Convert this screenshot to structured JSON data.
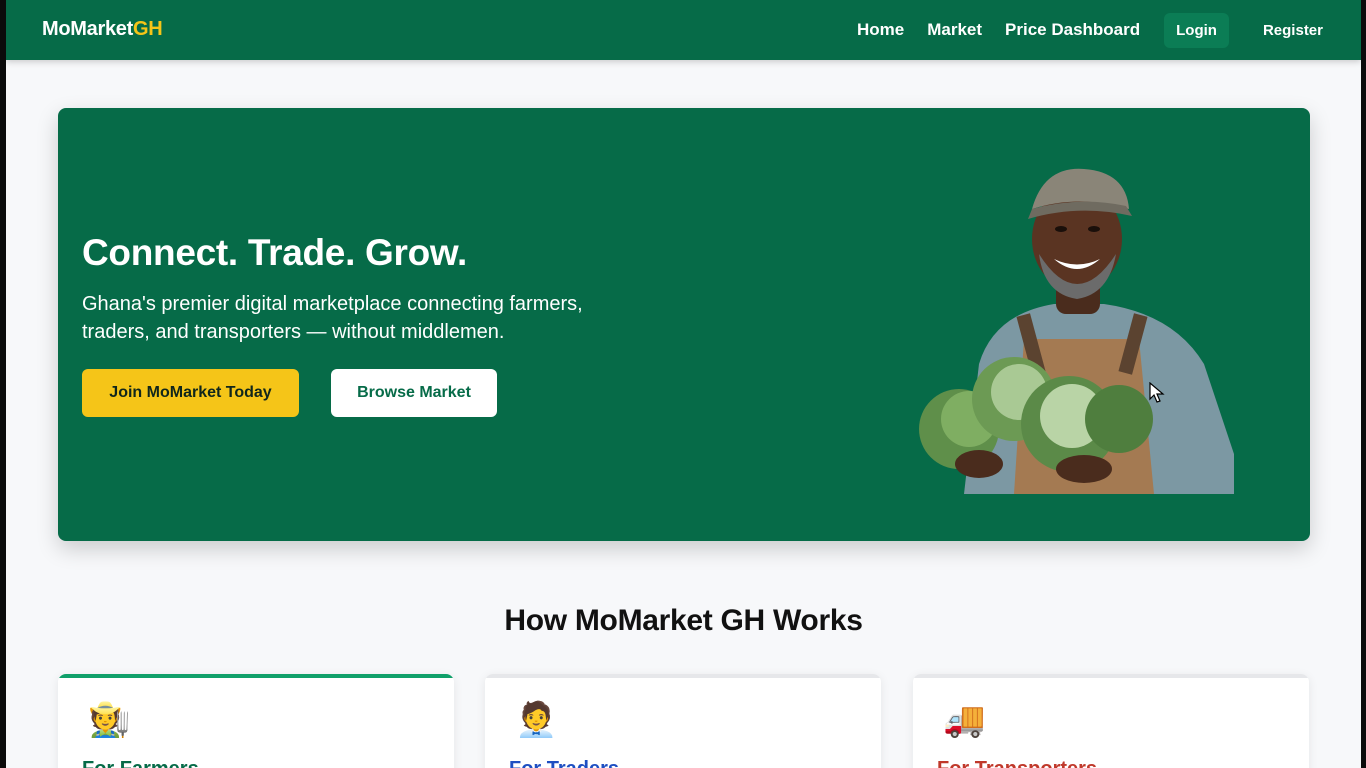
{
  "nav": {
    "brand_main": "MoMarket",
    "brand_accent": "GH",
    "links": [
      "Home",
      "Market",
      "Price Dashboard"
    ],
    "login": "Login",
    "register": "Register"
  },
  "hero": {
    "title": "Connect. Trade. Grow.",
    "subtitle": "Ghana's premier digital marketplace connecting farmers, traders, and transporters — without middlemen.",
    "primary_button": "Join MoMarket Today",
    "secondary_button": "Browse Market",
    "image": "farmer-holding-cabbages"
  },
  "how_it_works": {
    "title": "How MoMarket GH Works",
    "cards": [
      {
        "icon": "farmer-emoji",
        "emoji": "🧑‍🌾",
        "title": "For Farmers",
        "color": "#066b48"
      },
      {
        "icon": "trader-emoji",
        "emoji": "🧑‍💼",
        "title": "For Traders",
        "color": "#1e4fc2"
      },
      {
        "icon": "truck-emoji",
        "emoji": "🚚",
        "title": "For Transporters",
        "color": "#c0392b"
      }
    ]
  },
  "colors": {
    "primary_green": "#066b48",
    "accent_yellow": "#f5c518"
  }
}
